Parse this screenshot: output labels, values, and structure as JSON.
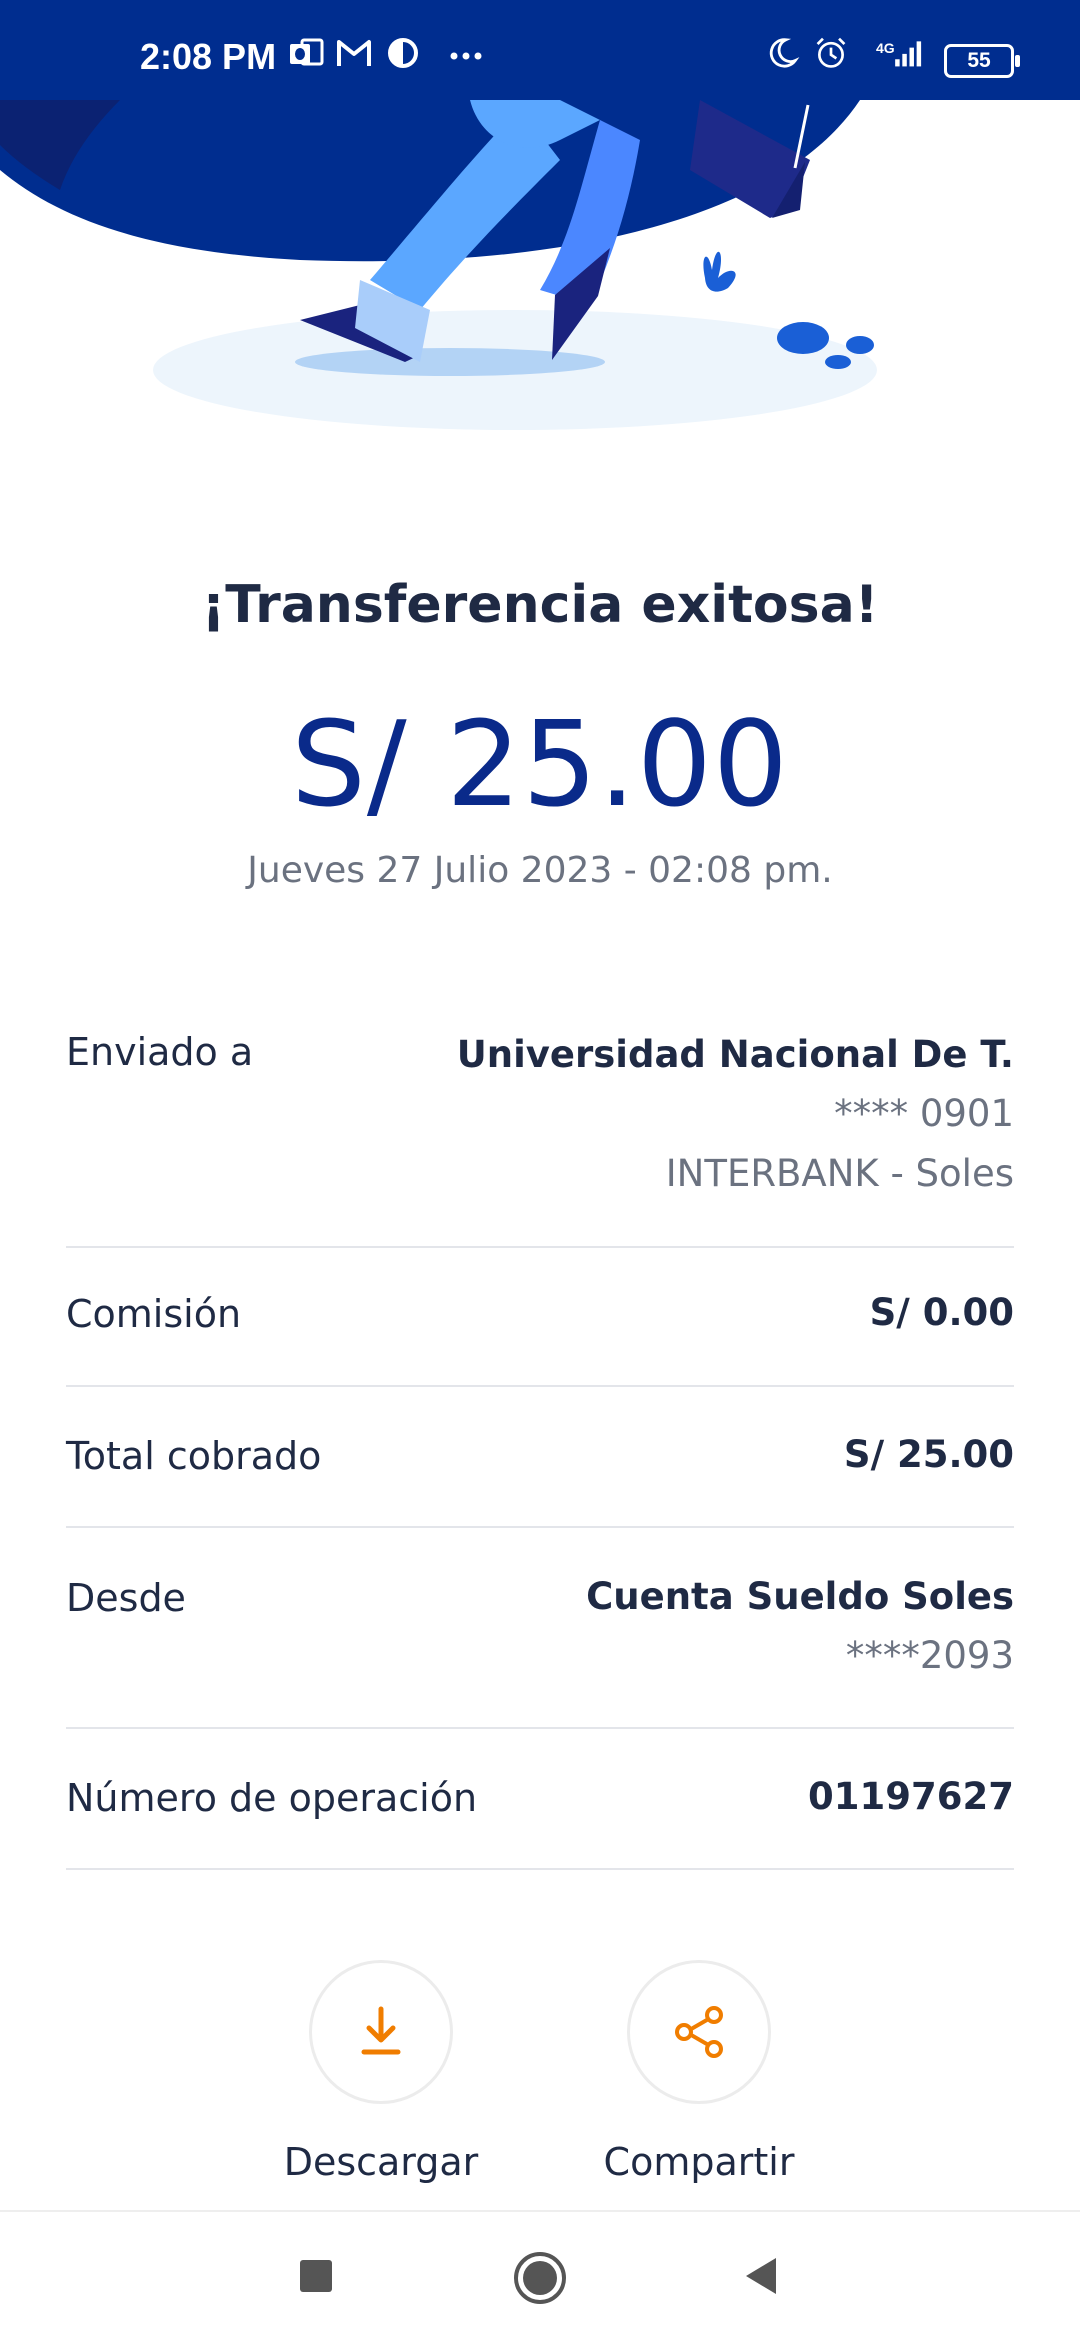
{
  "status_bar": {
    "time": "2:08 PM",
    "battery": "55",
    "network": "4G",
    "icons": [
      "outlook-icon",
      "gmail-icon",
      "half-circle-icon",
      "more-dots-icon",
      "moon-icon",
      "alarm-icon",
      "signal-icon",
      "battery-icon"
    ]
  },
  "receipt": {
    "title": "¡Transferencia exitosa!",
    "amount": "S/ 25.00",
    "datetime": "Jueves 27 Julio 2023 - 02:08 pm."
  },
  "details": {
    "sent_to": {
      "label": "Enviado a",
      "name": "Universidad Nacional De T.",
      "account": "**** 0901",
      "bank": "INTERBANK - Soles"
    },
    "commission": {
      "label": "Comisión",
      "value": "S/ 0.00"
    },
    "total": {
      "label": "Total cobrado",
      "value": "S/ 25.00"
    },
    "from": {
      "label": "Desde",
      "account_name": "Cuenta Sueldo Soles",
      "account_number": "****2093"
    },
    "operation": {
      "label": "Número de operación",
      "value": "01197627"
    }
  },
  "actions": {
    "download_label": "Descargar",
    "share_label": "Compartir"
  },
  "colors": {
    "brand_blue": "#002d8f",
    "amount_blue": "#0a2a8a",
    "accent_orange": "#f07d00"
  }
}
